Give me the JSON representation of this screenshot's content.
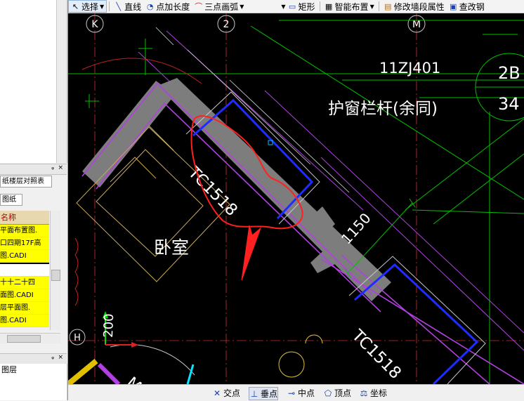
{
  "toolbar": {
    "select_label": "选择",
    "line_label": "直线",
    "point_length_label": "点加长度",
    "arc_label": "三点画弧",
    "rect_label": "矩形",
    "smart_layout_label": "智能布置",
    "edit_wall_label": "修改墙段属性",
    "check_label": "查改钢"
  },
  "left": {
    "tab_floor_table": "纸楼层对照表",
    "tab_drawings": "图纸",
    "list_header": "名称",
    "rows": [
      "平面布置图.",
      "口四期17F高",
      "图.CADI",
      "",
      "十十二十四",
      "面图.CADI",
      "层平面图.",
      "图.CADI"
    ],
    "layers_label": "图层",
    "panel_pin": "ᵩ",
    "panel_close": "×"
  },
  "drawing": {
    "axis_k": "K",
    "axis_2": "2",
    "axis_m": "M",
    "axis_h": "H",
    "atlas_code": "11ZJ401",
    "annotation": "护窗栏杆(余同)",
    "detail_top": "2B",
    "detail_bottom": "34",
    "window_1": "TC1518",
    "window_2": "TC1518",
    "room": "卧室",
    "dim_1150": "1150",
    "dim_200": "200",
    "partial_letter": "M"
  },
  "status": {
    "intersection": "交点",
    "perpendicular": "垂点",
    "midpoint": "中点",
    "vertex": "顶点",
    "coordinate": "坐标"
  },
  "colors": {
    "canvas_bg": "#000000",
    "wall": "#808080",
    "purple": "#b040e0",
    "green": "#00c000",
    "window_blue": "#1e2cff",
    "text": "#ffffff",
    "markup_red": "#ff2020",
    "yellow_row": "#ffff00"
  }
}
